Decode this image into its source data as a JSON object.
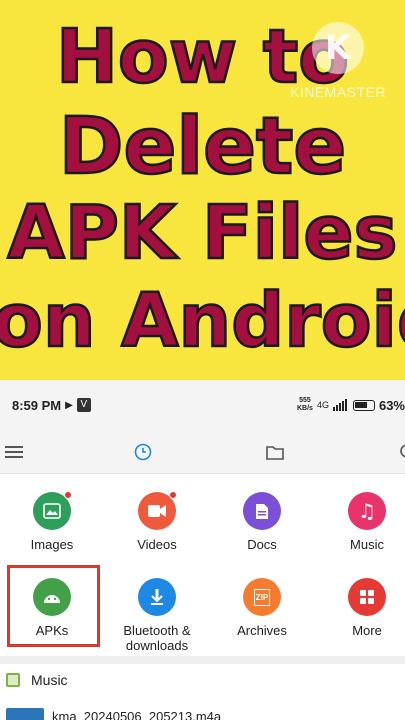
{
  "banner": {
    "lines": [
      "How to",
      "Delete",
      "APK Files",
      "on Android"
    ],
    "watermark_text": "KINEMASTER",
    "watermark_logo": "K",
    "bg_color": "#f8e63f",
    "text_color": "#a3103f"
  },
  "statusbar": {
    "time": "8:59 PM",
    "speed": "555\nKB/s",
    "network": "4G",
    "battery": "63%"
  },
  "appbar": {
    "icons": [
      "menu-icon",
      "recent-clock-icon",
      "folder-icon",
      "search-icon"
    ]
  },
  "categories": [
    {
      "label": "Images",
      "color": "#2e9e5b",
      "icon": "image-icon",
      "dot": true
    },
    {
      "label": "Videos",
      "color": "#ef5a3c",
      "icon": "video-icon",
      "dot": true
    },
    {
      "label": "Docs",
      "color": "#7b4fd6",
      "icon": "doc-icon",
      "dot": false
    },
    {
      "label": "Music",
      "color": "#e8336b",
      "icon": "music-note-icon",
      "dot": false
    },
    {
      "label": "APKs",
      "color": "#43a047",
      "icon": "android-icon",
      "dot": false
    },
    {
      "label": "Bluetooth & downloads",
      "color": "#1e88e5",
      "icon": "download-icon",
      "dot": false
    },
    {
      "label": "Archives",
      "color": "#f57c2e",
      "icon": "zip-icon",
      "dot": false,
      "badge": "ZIP"
    },
    {
      "label": "More",
      "color": "#e53935",
      "icon": "grid-icon",
      "dot": false
    }
  ],
  "section": {
    "label": "Music"
  },
  "file": {
    "name": "kma_20240506_205213.m4a"
  }
}
